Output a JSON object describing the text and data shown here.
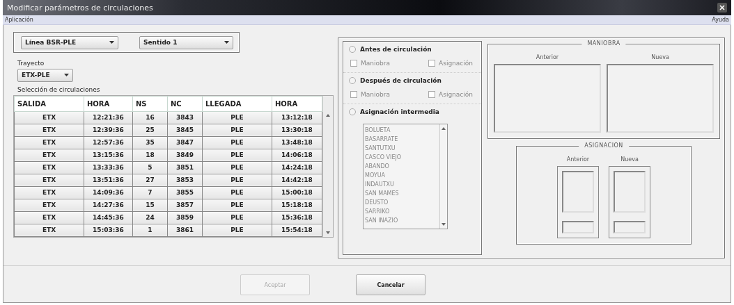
{
  "window": {
    "title": "Modificar parámetros de circulaciones"
  },
  "menu_bar": {
    "left_menus": [
      "Aplicación"
    ],
    "right_menus": [
      "Ayuda"
    ]
  },
  "line_select": {
    "value": "Línea BSR-PLE"
  },
  "direction_select": {
    "value": "Sentido 1"
  },
  "route": {
    "label": "Trayecto",
    "value": "ETX-PLE"
  },
  "table": {
    "title": "Selección de circulaciones",
    "columns": [
      "SALIDA",
      "HORA",
      "NS",
      "NC",
      "LLEGADA",
      "HORA"
    ],
    "rows": [
      [
        "ETX",
        "12:21:36",
        "16",
        "3843",
        "PLE",
        "13:12:18"
      ],
      [
        "ETX",
        "12:39:36",
        "25",
        "3845",
        "PLE",
        "13:30:18"
      ],
      [
        "ETX",
        "12:57:36",
        "35",
        "3847",
        "PLE",
        "13:48:18"
      ],
      [
        "ETX",
        "13:15:36",
        "18",
        "3849",
        "PLE",
        "14:06:18"
      ],
      [
        "ETX",
        "13:33:36",
        "5",
        "3851",
        "PLE",
        "14:24:18"
      ],
      [
        "ETX",
        "13:51:36",
        "27",
        "3853",
        "PLE",
        "14:42:18"
      ],
      [
        "ETX",
        "14:09:36",
        "7",
        "3855",
        "PLE",
        "15:00:18"
      ],
      [
        "ETX",
        "14:27:36",
        "15",
        "3857",
        "PLE",
        "15:18:18"
      ],
      [
        "ETX",
        "14:45:36",
        "24",
        "3859",
        "PLE",
        "15:36:18"
      ],
      [
        "ETX",
        "15:03:36",
        "1",
        "3861",
        "PLE",
        "15:54:18"
      ]
    ]
  },
  "timing": {
    "options": [
      {
        "kind": "checks",
        "label": "Antes de circulación",
        "selected": false,
        "checks": [
          {
            "label": "Maniobra",
            "checked": false
          },
          {
            "label": "Asignación",
            "checked": false
          }
        ]
      },
      {
        "kind": "checks",
        "label": "Después de circulación",
        "selected": false,
        "checks": [
          {
            "label": "Maniobra",
            "checked": false
          },
          {
            "label": "Asignación",
            "checked": false
          }
        ]
      },
      {
        "kind": "list",
        "label": "Asignación intermedia",
        "selected": false,
        "items": [
          {
            "label": "BOLUETA",
            "selected": false
          },
          {
            "label": "BASARRATE",
            "selected": false
          },
          {
            "label": "SANTUTXU",
            "selected": false
          },
          {
            "label": "CASCO VIEJO",
            "selected": false
          },
          {
            "label": "ABANDO",
            "selected": false
          },
          {
            "label": "MOYUA",
            "selected": false
          },
          {
            "label": "INDAUTXU",
            "selected": false
          },
          {
            "label": "SAN MAMES",
            "selected": false
          },
          {
            "label": "DEUSTO",
            "selected": false
          },
          {
            "label": "SARRIKO",
            "selected": false
          },
          {
            "label": "SAN INAZIO",
            "selected": false
          }
        ]
      }
    ]
  },
  "maneuver": {
    "title": "MANIOBRA",
    "columns": [
      "Anterior",
      "Nueva"
    ]
  },
  "assignment": {
    "title": "ASIGNACION",
    "columns": [
      "Anterior",
      "Nueva"
    ]
  },
  "buttons": [
    {
      "label": "Aceptar",
      "disabled": true
    },
    {
      "label": "Cancelar",
      "disabled": false
    }
  ]
}
